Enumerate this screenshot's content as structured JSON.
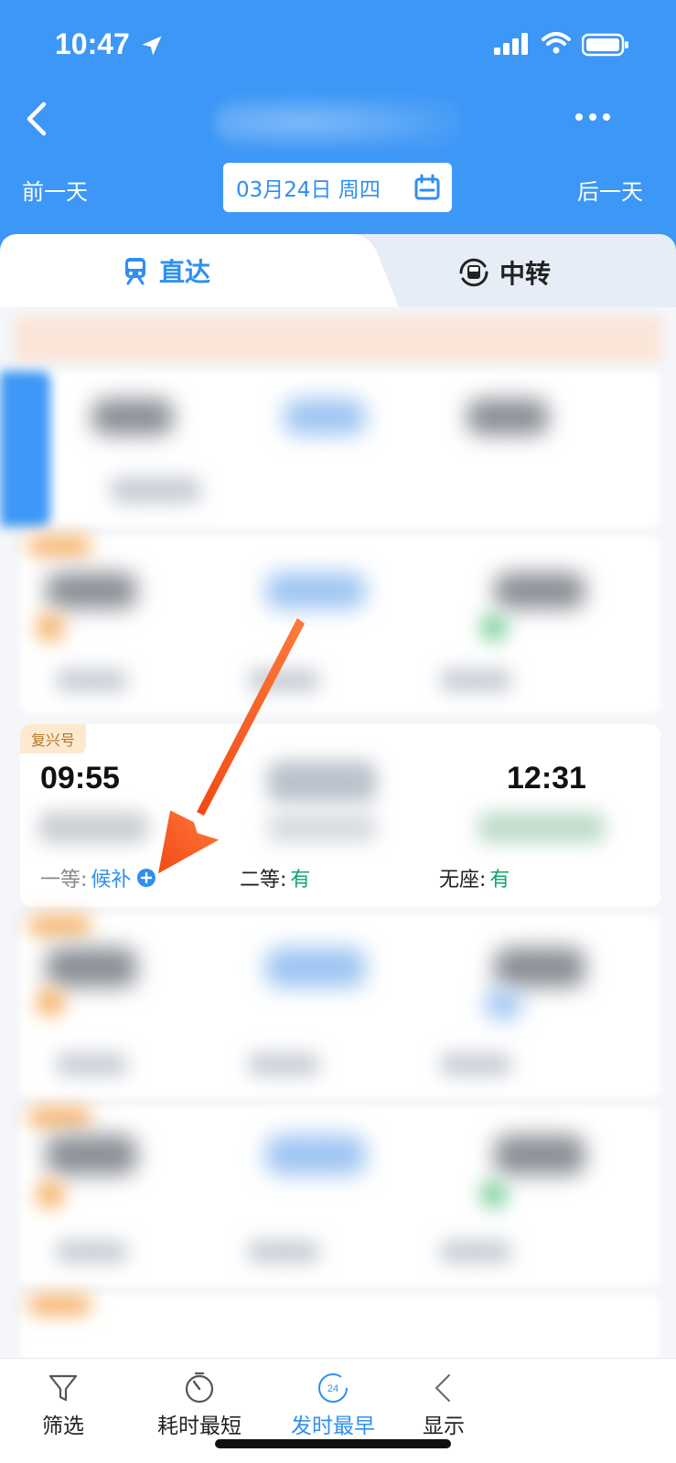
{
  "status_bar": {
    "time": "10:47"
  },
  "nav": {
    "prev_day": "前一天",
    "next_day": "后一天",
    "date": "03月24日 周四"
  },
  "tabs": [
    {
      "label": "直达",
      "active": true
    },
    {
      "label": "中转",
      "active": false
    }
  ],
  "train_card": {
    "badge": "复兴号",
    "departure_time": "09:55",
    "arrival_time": "12:31",
    "seats": [
      {
        "label": "一等:",
        "value": "候补",
        "state": "waitlist"
      },
      {
        "label": "二等:",
        "value": "有",
        "state": "available"
      },
      {
        "label": "无座:",
        "value": "有",
        "state": "available"
      }
    ]
  },
  "bottom_bar": [
    {
      "label": "筛选",
      "icon": "filter-icon",
      "active": false
    },
    {
      "label": "耗时最短",
      "icon": "stopwatch-icon",
      "active": false
    },
    {
      "label": "发时最早",
      "icon": "clock-24-icon",
      "active": true,
      "icon_text": "24"
    },
    {
      "label": "显示",
      "icon": "chevron-left-icon",
      "active": false
    }
  ],
  "colors": {
    "header_blue": "#3d97f6",
    "accent_blue": "#2f8ff0",
    "available_green": "#16a36a",
    "arrow_orange": "#f05a22"
  }
}
